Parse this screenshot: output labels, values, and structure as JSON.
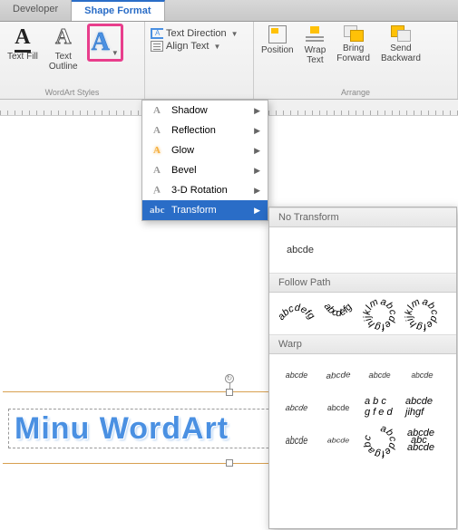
{
  "tabs": {
    "developer": "Developer",
    "shape_format": "Shape Format"
  },
  "ribbon": {
    "wordart_group": "WordArt Styles",
    "text_fill": "Text Fill",
    "text_outline": "Text\nOutline",
    "text_direction": "Text Direction",
    "align_text": "Align Text",
    "arrange_group": "Arrange",
    "position": "Position",
    "wrap_text": "Wrap\nText",
    "bring_forward": "Bring\nForward",
    "send_backward": "Send\nBackward"
  },
  "effects_menu": {
    "items": [
      "Shadow",
      "Reflection",
      "Glow",
      "Bevel",
      "3-D Rotation",
      "Transform"
    ],
    "active_index": 5
  },
  "transform_panel": {
    "no_transform_header": "No Transform",
    "no_transform_sample": "abcde",
    "follow_path_header": "Follow Path",
    "warp_header": "Warp",
    "sample": "abcde",
    "circle_sample": "abcdefg"
  },
  "wordart": {
    "text": "Minu WordArt"
  }
}
